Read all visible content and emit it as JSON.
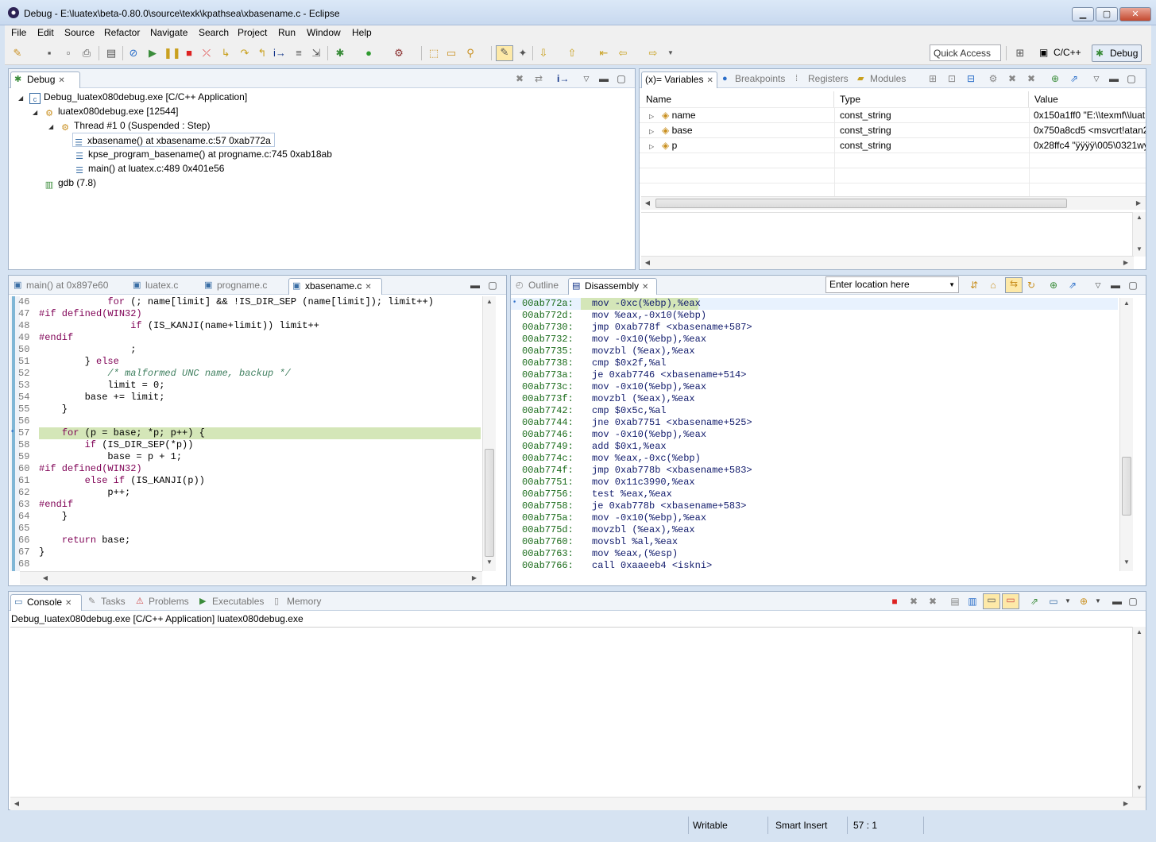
{
  "window": {
    "title": "Debug - E:\\luatex\\beta-0.80.0\\source\\texk\\kpathsea\\xbasename.c - Eclipse",
    "minimize_glyph": "▁",
    "maximize_glyph": "▢",
    "close_glyph": "✕"
  },
  "menu": [
    "File",
    "Edit",
    "Source",
    "Refactor",
    "Navigate",
    "Search",
    "Project",
    "Run",
    "Window",
    "Help"
  ],
  "toolbar": {
    "quick_access": "Quick Access",
    "perspectives": [
      {
        "label": "C/C++",
        "icon": "c-perspective-icon"
      },
      {
        "label": "Debug",
        "icon": "bug-perspective-icon",
        "active": true
      }
    ]
  },
  "debug_view": {
    "tab_label": "Debug",
    "tree": [
      {
        "label": "Debug_luatex080debug.exe [C/C++ Application]",
        "level": 0,
        "icon": "c-application-icon"
      },
      {
        "label": "luatex080debug.exe [12544]",
        "level": 1,
        "icon": "process-icon"
      },
      {
        "label": "Thread #1 0 (Suspended : Step)",
        "level": 2,
        "icon": "thread-icon"
      },
      {
        "label": "xbasename() at xbasename.c:57 0xab772a",
        "level": 3,
        "icon": "stack-frame-icon",
        "selected": true
      },
      {
        "label": "kpse_program_basename() at progname.c:745 0xab18ab",
        "level": 3,
        "icon": "stack-frame-icon"
      },
      {
        "label": "main() at luatex.c:489 0x401e56",
        "level": 3,
        "icon": "stack-frame-icon"
      },
      {
        "label": "gdb (7.8)",
        "level": 1,
        "icon": "gdb-icon"
      }
    ]
  },
  "variables_view": {
    "tabs": [
      {
        "label": "(x)= Variables",
        "active": true
      },
      {
        "label": "Breakpoints"
      },
      {
        "label": "Registers"
      },
      {
        "label": "Modules"
      }
    ],
    "columns": [
      "Name",
      "Type",
      "Value"
    ],
    "rows": [
      {
        "name": "name",
        "type": "const_string",
        "value": "0x150a1ff0 \"E:\\\\texmf\\\\luat"
      },
      {
        "name": "base",
        "type": "const_string",
        "value": "0x750a8cd5 <msvcrt!atan2+"
      },
      {
        "name": "p",
        "type": "const_string",
        "value": "0x28ffc4 \"ÿÿÿÿ\\005\\0321wy"
      }
    ]
  },
  "editor": {
    "tabs": [
      {
        "label": "main() at 0x897e60"
      },
      {
        "label": "luatex.c"
      },
      {
        "label": "progname.c"
      },
      {
        "label": "xbasename.c",
        "active": true
      }
    ],
    "lines": [
      {
        "n": "46",
        "t": "            for (; name[limit] && !IS_DIR_SEP (name[limit]); limit++)"
      },
      {
        "n": "47",
        "t": "#if defined(WIN32)"
      },
      {
        "n": "48",
        "t": "                if (IS_KANJI(name+limit)) limit++"
      },
      {
        "n": "49",
        "t": "#endif"
      },
      {
        "n": "50",
        "t": "                ;"
      },
      {
        "n": "51",
        "t": "        } else"
      },
      {
        "n": "52",
        "t": "            /* malformed UNC name, backup */"
      },
      {
        "n": "53",
        "t": "            limit = 0;"
      },
      {
        "n": "54",
        "t": "        base += limit;"
      },
      {
        "n": "55",
        "t": "    }"
      },
      {
        "n": "56",
        "t": ""
      },
      {
        "n": "57",
        "t": "    for (p = base; *p; p++) {"
      },
      {
        "n": "58",
        "t": "        if (IS_DIR_SEP(*p))"
      },
      {
        "n": "59",
        "t": "            base = p + 1;"
      },
      {
        "n": "60",
        "t": "#if defined(WIN32)"
      },
      {
        "n": "61",
        "t": "        else if (IS_KANJI(p))"
      },
      {
        "n": "62",
        "t": "            p++;"
      },
      {
        "n": "63",
        "t": "#endif"
      },
      {
        "n": "64",
        "t": "    }"
      },
      {
        "n": "65",
        "t": ""
      },
      {
        "n": "66",
        "t": "    return base;"
      },
      {
        "n": "67",
        "t": "}"
      },
      {
        "n": "68",
        "t": ""
      }
    ]
  },
  "disassembly_view": {
    "tabs": [
      {
        "label": "Outline"
      },
      {
        "label": "Disassembly",
        "active": true
      }
    ],
    "location_placeholder": "Enter location here",
    "lines": [
      {
        "a": "00ab772a:",
        "i": "mov -0xc(%ebp),%eax"
      },
      {
        "a": "00ab772d:",
        "i": "mov %eax,-0x10(%ebp)"
      },
      {
        "a": "00ab7730:",
        "i": "jmp 0xab778f <xbasename+587>"
      },
      {
        "a": "00ab7732:",
        "i": "mov -0x10(%ebp),%eax"
      },
      {
        "a": "00ab7735:",
        "i": "movzbl (%eax),%eax"
      },
      {
        "a": "00ab7738:",
        "i": "cmp $0x2f,%al"
      },
      {
        "a": "00ab773a:",
        "i": "je 0xab7746 <xbasename+514>"
      },
      {
        "a": "00ab773c:",
        "i": "mov -0x10(%ebp),%eax"
      },
      {
        "a": "00ab773f:",
        "i": "movzbl (%eax),%eax"
      },
      {
        "a": "00ab7742:",
        "i": "cmp $0x5c,%al"
      },
      {
        "a": "00ab7744:",
        "i": "jne 0xab7751 <xbasename+525>"
      },
      {
        "a": "00ab7746:",
        "i": "mov -0x10(%ebp),%eax"
      },
      {
        "a": "00ab7749:",
        "i": "add $0x1,%eax"
      },
      {
        "a": "00ab774c:",
        "i": "mov %eax,-0xc(%ebp)"
      },
      {
        "a": "00ab774f:",
        "i": "jmp 0xab778b <xbasename+583>"
      },
      {
        "a": "00ab7751:",
        "i": "mov 0x11c3990,%eax"
      },
      {
        "a": "00ab7756:",
        "i": "test %eax,%eax"
      },
      {
        "a": "00ab7758:",
        "i": "je 0xab778b <xbasename+583>"
      },
      {
        "a": "00ab775a:",
        "i": "mov -0x10(%ebp),%eax"
      },
      {
        "a": "00ab775d:",
        "i": "movzbl (%eax),%eax"
      },
      {
        "a": "00ab7760:",
        "i": "movsbl %al,%eax"
      },
      {
        "a": "00ab7763:",
        "i": "mov %eax,(%esp)"
      },
      {
        "a": "00ab7766:",
        "i": "call 0xaaeeb4 <iskni>"
      }
    ]
  },
  "console_view": {
    "tabs": [
      {
        "label": "Console",
        "active": true
      },
      {
        "label": "Tasks"
      },
      {
        "label": "Problems"
      },
      {
        "label": "Executables"
      },
      {
        "label": "Memory"
      }
    ],
    "process_label": "Debug_luatex080debug.exe [C/C++ Application] luatex080debug.exe"
  },
  "statusbar": {
    "writable": "Writable",
    "insert_mode": "Smart Insert",
    "position": "57 : 1"
  },
  "colors": {
    "current_line_highlight": "#d4e6b8",
    "keyword": "#7f0055",
    "comment": "#3f7f5f",
    "address": "#1a6b1a"
  }
}
